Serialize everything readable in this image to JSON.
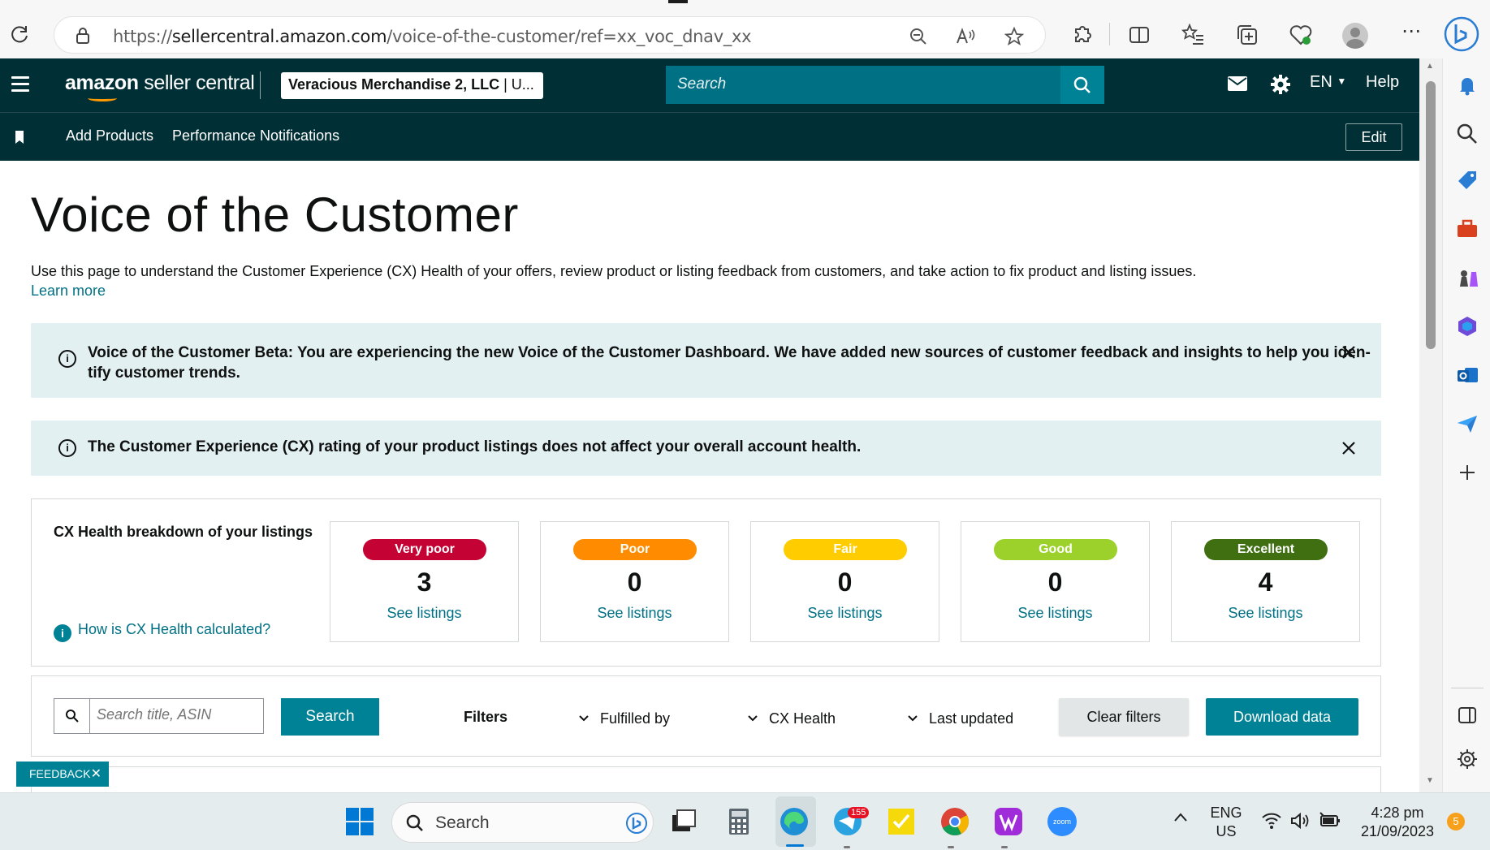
{
  "browser": {
    "url_prefix": "https://",
    "url_domain": "sellercentral.amazon.com",
    "url_path": "/voice-of-the-customer/ref=xx_voc_dnav_xx"
  },
  "nav": {
    "brand_bold": "amazon",
    "brand_rest": " seller central",
    "merchant_bold": "Veracious Merchandise 2, LLC",
    "merchant_rest": " | U...",
    "search_placeholder": "Search",
    "language": "EN",
    "help": "Help",
    "links": [
      "Add Products",
      "Performance Notifications"
    ],
    "edit": "Edit"
  },
  "page": {
    "title": "Voice of the Customer",
    "description": "Use this page to understand the Customer Experience (CX) Health of your offers, review product or listing feedback from customers, and take action to fix product and listing issues.",
    "learn_more": "Learn more"
  },
  "banners": [
    {
      "line1": "Voice of the Customer Beta: You are experiencing the new Voice of the Customer Dashboard. We have added new sources of customer feedback and insights to help you iden-",
      "line2": "tify customer trends."
    },
    {
      "line1": "The Customer Experience (CX) rating of your product listings does not affect your overall account health.",
      "line2": ""
    }
  ],
  "cx": {
    "title": "CX Health breakdown of your listings",
    "help_link": "How is CX Health calculated?",
    "cards": [
      {
        "label": "Very poor",
        "count": "3",
        "link": "See listings",
        "color": "#c40233",
        "text_color": "#ffffff"
      },
      {
        "label": "Poor",
        "count": "0",
        "link": "See listings",
        "color": "#ff8c00",
        "text_color": "#ffffff"
      },
      {
        "label": "Fair",
        "count": "0",
        "link": "See listings",
        "color": "#ffcc00",
        "text_color": "#ffffff"
      },
      {
        "label": "Good",
        "count": "0",
        "link": "See listings",
        "color": "#9bd12a",
        "text_color": "#ffffff"
      },
      {
        "label": "Excellent",
        "count": "4",
        "link": "See listings",
        "color": "#3f6f10",
        "text_color": "#ffffff"
      }
    ]
  },
  "filters": {
    "search_placeholder": "Search title, ASIN",
    "search_button": "Search",
    "label": "Filters",
    "dropdowns": [
      "Fulfilled by",
      "CX Health",
      "Last updated"
    ],
    "clear": "Clear filters",
    "download": "Download data"
  },
  "feedback": "FEEDBACK",
  "taskbar": {
    "search": "Search",
    "telegram_badge": "155",
    "lang_line1": "ENG",
    "lang_line2": "US",
    "time": "4:28 pm",
    "date": "21/09/2023",
    "notif_count": "5"
  }
}
